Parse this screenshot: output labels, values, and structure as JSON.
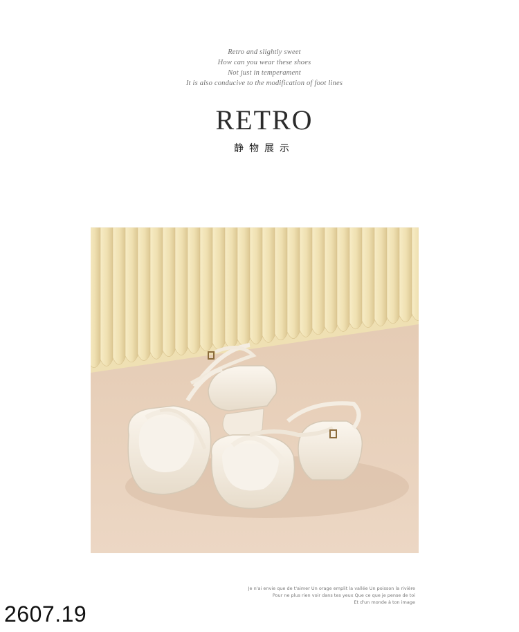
{
  "tagline": {
    "lines": [
      "Retro and slightly sweet",
      "How can you wear these shoes",
      "Not just in temperament",
      "It is also conducive to the modification of foot lines"
    ]
  },
  "title": "RETRO",
  "subtitle": "静物展示",
  "photo": {
    "icon": "sandal-product-photo",
    "colors": {
      "backdrop": "#f1e3b8",
      "floor": "#e9d2bd",
      "sandal": "#f4ede2"
    }
  },
  "caption": {
    "lines": [
      "Je n'ai envie que de t'aimer Un orage emplit la vallée Un poisson la rivière",
      "Pour ne plus rien voir dans tes yeux Que ce que je pense de toi",
      "Et d'un monde à ton image"
    ]
  },
  "product_code": "2607.19"
}
